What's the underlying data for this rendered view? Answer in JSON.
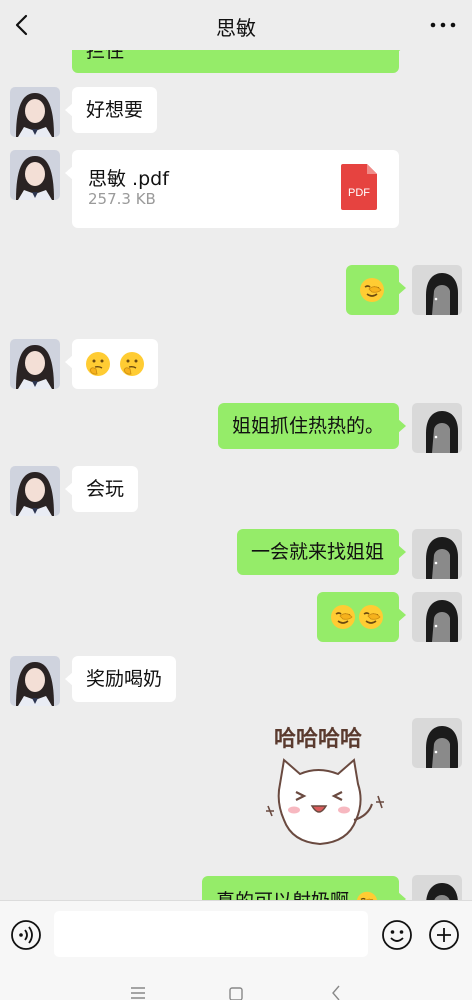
{
  "header": {
    "title": "思敏"
  },
  "messages": {
    "top_partial": "拦住",
    "m1": "好想要",
    "file": {
      "name": "思敏 .pdf",
      "size": "257.3 KB",
      "icon_label": "PDF"
    },
    "m3_emoji": [
      "face-with-hand-over-eye"
    ],
    "m4_emoji": [
      "thinking-face",
      "thinking-face"
    ],
    "m5": "姐姐抓住热热的。",
    "m6": "会玩",
    "m7": "一会就来找姐姐",
    "m8_emoji": [
      "face-with-hand-over-eye",
      "face-with-hand-over-eye"
    ],
    "m9": "奖励喝奶",
    "sticker": {
      "caption": "哈哈哈哈",
      "name": "laughing-cat-sticker"
    },
    "m11": "真的可以射奶啊"
  },
  "input": {
    "value": "",
    "placeholder": ""
  },
  "colors": {
    "background": "#ededed",
    "bubble_self": "#95ec69",
    "bubble_other": "#ffffff",
    "pdf_red": "#e64340"
  }
}
